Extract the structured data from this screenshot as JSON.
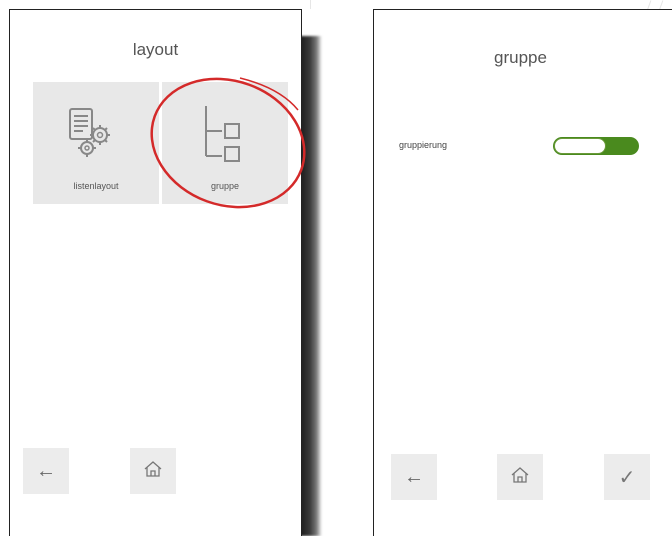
{
  "left_screen": {
    "title": "layout",
    "tiles": [
      {
        "label": "listenlayout",
        "icon": "document-gears-icon"
      },
      {
        "label": "gruppe",
        "icon": "tree-structure-icon",
        "highlighted": true
      }
    ],
    "nav": [
      {
        "icon": "arrow-left-icon",
        "glyph": "←"
      },
      {
        "icon": "home-icon"
      }
    ]
  },
  "right_screen": {
    "title": "gruppe",
    "setting": {
      "label": "gruppierung",
      "toggle_state": "on"
    },
    "nav": [
      {
        "icon": "arrow-left-icon",
        "glyph": "←"
      },
      {
        "icon": "home-icon"
      },
      {
        "icon": "checkmark-icon",
        "glyph": "✓"
      }
    ]
  },
  "colors": {
    "tile_bg": "#e8e8e8",
    "toggle_on": "#4a8a1e",
    "annotation_circle": "#d42a2a",
    "text": "#555555"
  }
}
